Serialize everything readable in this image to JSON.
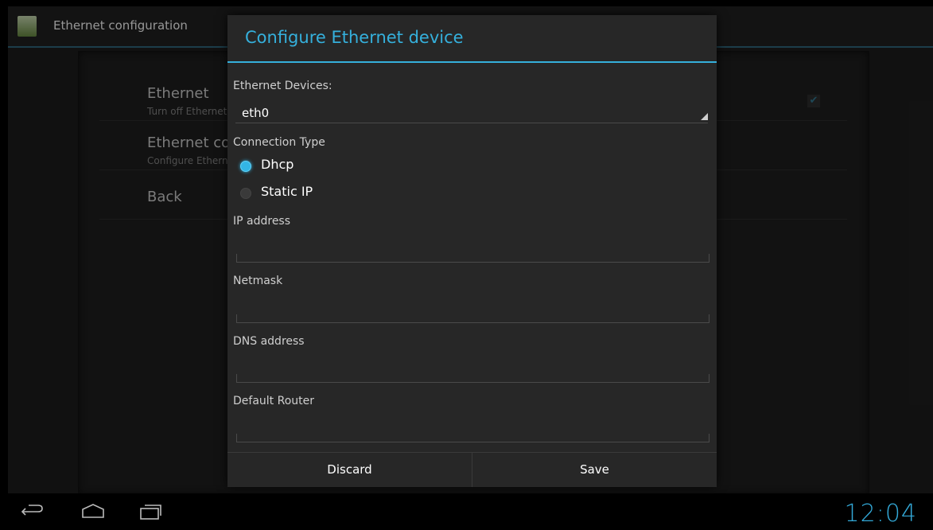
{
  "app": {
    "title": "Ethernet configuration",
    "prefs": [
      {
        "title": "Ethernet",
        "summary": "Turn off Ethernet",
        "checked": true
      },
      {
        "title": "Ethernet configuration",
        "summary": "Configure Ethernet device"
      },
      {
        "title": "Back"
      }
    ]
  },
  "dialog": {
    "title": "Configure Ethernet device",
    "devices_label": "Ethernet Devices:",
    "selected_device": "eth0",
    "connection_type_label": "Connection Type",
    "connection_types": [
      {
        "label": "Dhcp",
        "selected": true
      },
      {
        "label": "Static IP",
        "selected": false
      }
    ],
    "fields": [
      {
        "label": "IP address",
        "value": ""
      },
      {
        "label": "Netmask",
        "value": ""
      },
      {
        "label": "DNS address",
        "value": ""
      },
      {
        "label": "Default Router",
        "value": ""
      }
    ],
    "discard_label": "Discard",
    "save_label": "Save"
  },
  "system_bar": {
    "time": "12:04",
    "icons": [
      "back-icon",
      "home-icon",
      "recent-apps-icon"
    ]
  },
  "colors": {
    "accent": "#33b5e5",
    "dialog_bg": "#272727",
    "background": "#1b1b1b"
  }
}
